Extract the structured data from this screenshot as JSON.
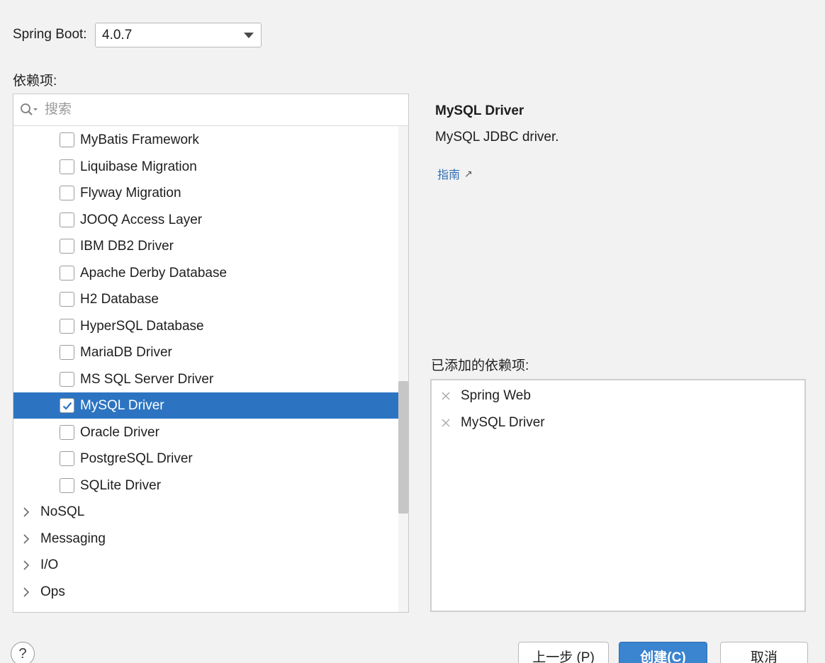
{
  "spring_boot": {
    "label": "Spring Boot:",
    "version": "4.0.7"
  },
  "dependencies": {
    "label": "依赖项:",
    "search_placeholder": "搜索",
    "items": [
      {
        "label": "MyBatis Framework",
        "checked": false
      },
      {
        "label": "Liquibase Migration",
        "checked": false
      },
      {
        "label": "Flyway Migration",
        "checked": false
      },
      {
        "label": "JOOQ Access Layer",
        "checked": false
      },
      {
        "label": "IBM DB2 Driver",
        "checked": false
      },
      {
        "label": "Apache Derby Database",
        "checked": false
      },
      {
        "label": "H2 Database",
        "checked": false
      },
      {
        "label": "HyperSQL Database",
        "checked": false
      },
      {
        "label": "MariaDB Driver",
        "checked": false
      },
      {
        "label": "MS SQL Server Driver",
        "checked": false
      },
      {
        "label": "MySQL Driver",
        "checked": true,
        "selected": true
      },
      {
        "label": "Oracle Driver",
        "checked": false
      },
      {
        "label": "PostgreSQL Driver",
        "checked": false
      },
      {
        "label": "SQLite Driver",
        "checked": false
      }
    ],
    "categories": [
      {
        "label": "NoSQL"
      },
      {
        "label": "Messaging"
      },
      {
        "label": "I/O"
      },
      {
        "label": "Ops"
      }
    ]
  },
  "detail": {
    "title": "MySQL Driver",
    "description": "MySQL JDBC driver.",
    "guide_link": "指南",
    "guide_arrow": "↗"
  },
  "added": {
    "label": "已添加的依赖项:",
    "items": [
      {
        "label": "Spring Web"
      },
      {
        "label": "MySQL Driver"
      }
    ]
  },
  "footer": {
    "help": "?",
    "prev_label": "上一步 (P)",
    "create_label": "创建(C)",
    "cancel_label": "取消"
  },
  "colors": {
    "selection": "#2c74c1",
    "primary_button": "#3b84cf",
    "link": "#2f6eb3",
    "background": "#f2f2f2"
  }
}
